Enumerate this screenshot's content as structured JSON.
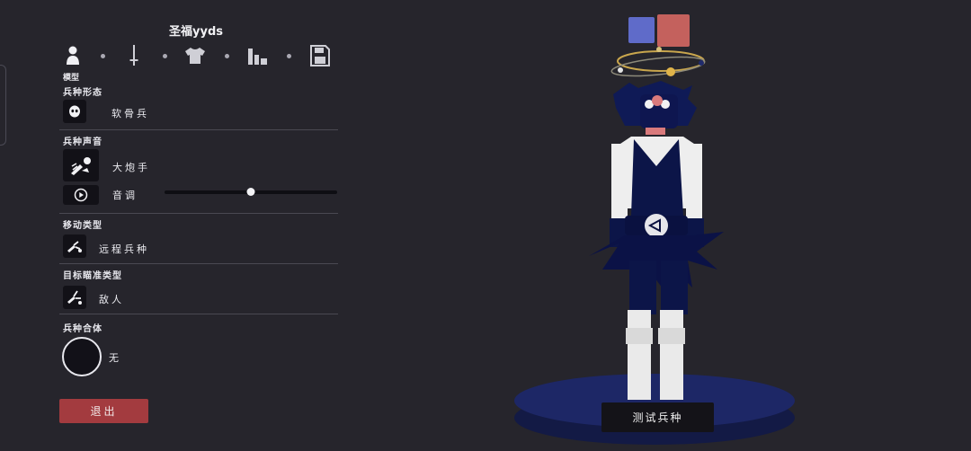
{
  "header": {
    "unit_name": "圣福yyds"
  },
  "tabs": {
    "items": [
      {
        "name": "model",
        "icon": "person-icon"
      },
      {
        "name": "weapon",
        "icon": "sword-icon"
      },
      {
        "name": "clothing",
        "icon": "shirt-icon"
      },
      {
        "name": "stats",
        "icon": "bar-chart-icon"
      },
      {
        "name": "save",
        "icon": "floppy-disk-icon"
      }
    ],
    "active_caption": "模型"
  },
  "sections": {
    "unit_form": {
      "label": "兵种形态",
      "value": "软骨兵",
      "icon": "skull-icon"
    },
    "unit_voice": {
      "label": "兵种声音",
      "value": "大炮手",
      "icon": "cannon-icon",
      "pitch_label": "音调",
      "pitch_value": 0.5,
      "play_icon": "play-icon"
    },
    "movement": {
      "label": "移动类型",
      "value": "远程兵种",
      "icon": "ranged-figure-icon"
    },
    "targeting": {
      "label": "目标瞄准类型",
      "value": "敌人",
      "icon": "target-figure-icon"
    },
    "combo": {
      "label": "兵种合体",
      "value": "无"
    }
  },
  "buttons": {
    "exit": "退出",
    "test": "测试兵种"
  },
  "colors": {
    "swatch_primary": "#5f6bc9",
    "swatch_secondary": "#c4615d",
    "exit_button": "#a33b3f",
    "background": "#26252c"
  }
}
